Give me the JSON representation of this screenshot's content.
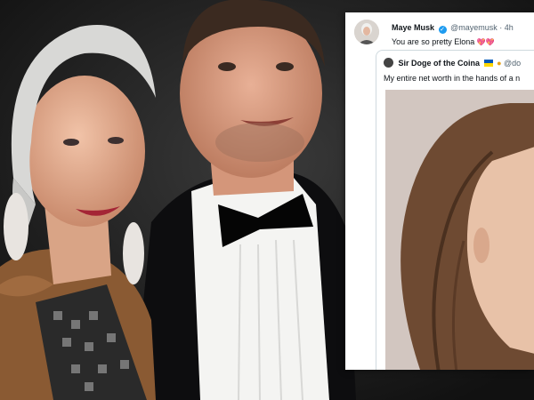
{
  "tweet": {
    "author_name": "Maye Musk",
    "author_handle": "@mayemusk",
    "separator": "·",
    "time": "4h",
    "text": "You are so pretty Elona",
    "emoji": "💖💖",
    "icons": [
      "verified-badge-icon",
      "heart-emoji-icon"
    ]
  },
  "quoted_tweet": {
    "author_name": "Sir Doge of the Coina",
    "author_handle": "@do",
    "text": "My entire net worth in the hands of a n",
    "icons": [
      "doge-avatar-icon",
      "ukraine-flag-icon",
      "cat-emoji-icon"
    ]
  },
  "colors": {
    "verified": "#1d9bf0",
    "handle_gray": "#536471",
    "heart": "#e0245e",
    "flag_blue": "#0057b7",
    "flag_yellow": "#ffd700"
  }
}
